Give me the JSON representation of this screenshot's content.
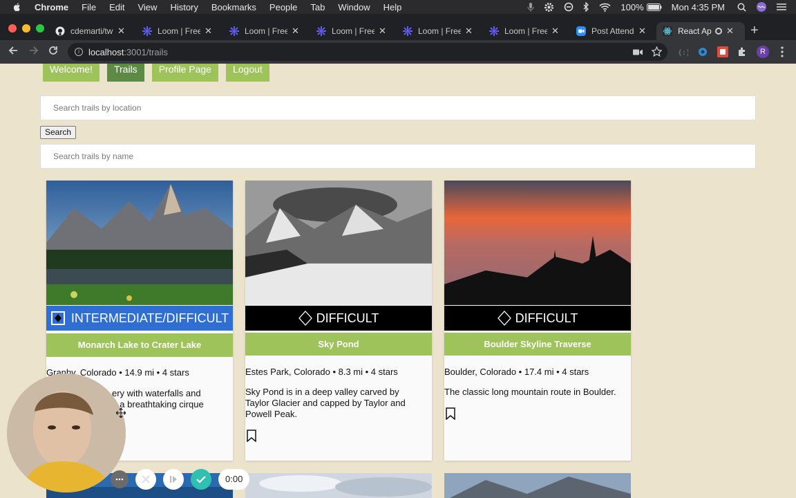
{
  "menubar": {
    "app": "Chrome",
    "items": [
      "File",
      "Edit",
      "View",
      "History",
      "Bookmarks",
      "People",
      "Tab",
      "Window",
      "Help"
    ],
    "battery": "100%",
    "clock": "Mon 4:35 PM"
  },
  "tabs": [
    {
      "title": "cdemarti/twi",
      "icon": "github-icon"
    },
    {
      "title": "Loom | Free S",
      "icon": "loom-icon"
    },
    {
      "title": "Loom | Free S",
      "icon": "loom-icon"
    },
    {
      "title": "Loom | Free S",
      "icon": "loom-icon"
    },
    {
      "title": "Loom | Free S",
      "icon": "loom-icon"
    },
    {
      "title": "Loom | Free S",
      "icon": "loom-icon"
    },
    {
      "title": "Post Attende",
      "icon": "zoom-icon"
    },
    {
      "title": "React Ap",
      "icon": "react-icon"
    }
  ],
  "address": {
    "host": "localhost",
    "path": ":3001/trails"
  },
  "profile_initial": "R",
  "nav": [
    "Welcome!",
    "Trails",
    "Profile Page",
    "Logout"
  ],
  "search": {
    "location_placeholder": "Search trails by location",
    "button": "Search",
    "name_placeholder": "Search trails by name"
  },
  "trails": [
    {
      "difficulty": "INTERMEDIATE/DIFFICULT",
      "name": "Monarch Lake to Crater Lake",
      "meta": "Granby, Colorado • 14.9 mi • 4 stars",
      "desc_line1": "ery with waterfalls and",
      "desc_line2": "g at a breathtaking cirque"
    },
    {
      "difficulty": "DIFFICULT",
      "name": "Sky Pond",
      "meta": "Estes Park, Colorado • 8.3 mi • 4 stars",
      "desc": "Sky Pond is in a deep valley carved by Taylor Glacier and capped by Taylor and Powell Peak."
    },
    {
      "difficulty": "DIFFICULT",
      "name": "Boulder Skyline Traverse",
      "meta": "Boulder, Colorado • 17.4 mi • 4 stars",
      "desc": "The classic long mountain route in Boulder."
    }
  ],
  "loom": {
    "timer": "0:00"
  },
  "colors": {
    "page_bg": "#ece3cd",
    "nav_green": "#9dc35a",
    "nav_active": "#5d8a45",
    "intermediate_blue": "#2f6fd4",
    "difficult_black": "#000000"
  }
}
